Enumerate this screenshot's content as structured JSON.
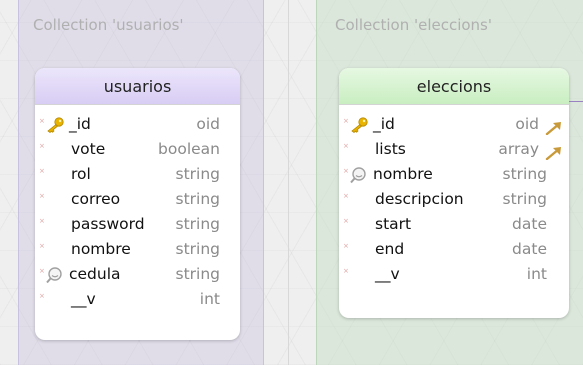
{
  "groups": [
    {
      "label": "Collection 'usuarios'"
    },
    {
      "label": "Collection 'eleccions'"
    }
  ],
  "tables": [
    {
      "title": "usuarios",
      "fields": [
        {
          "name": "_id",
          "type": "oid",
          "icon": "key-icon"
        },
        {
          "name": "vote",
          "type": "boolean"
        },
        {
          "name": "rol",
          "type": "string"
        },
        {
          "name": "correo",
          "type": "string"
        },
        {
          "name": "password",
          "type": "string"
        },
        {
          "name": "nombre",
          "type": "string"
        },
        {
          "name": "cedula",
          "type": "string",
          "icon": "index-icon"
        },
        {
          "name": "__v",
          "type": "int"
        }
      ]
    },
    {
      "title": "eleccions",
      "fields": [
        {
          "name": "_id",
          "type": "oid",
          "icon": "key-icon",
          "trailing_icon": "arrow-icon"
        },
        {
          "name": "lists",
          "type": "array",
          "trailing_icon": "arrow-icon"
        },
        {
          "name": "nombre",
          "type": "string",
          "icon": "index-icon"
        },
        {
          "name": "descripcion",
          "type": "string"
        },
        {
          "name": "start",
          "type": "date"
        },
        {
          "name": "end",
          "type": "date"
        },
        {
          "name": "__v",
          "type": "int"
        }
      ]
    }
  ],
  "colors": {
    "usuarios_header": "#d8cdf4",
    "eleccions_header": "#c9eec1",
    "key": "#e8b400",
    "relation_arrow": "#c99a3a",
    "type_text": "#8a8a8a"
  }
}
